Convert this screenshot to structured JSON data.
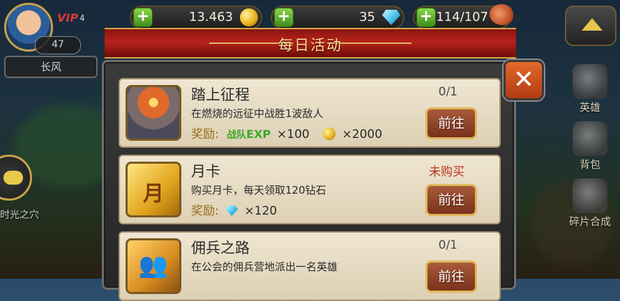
{
  "player": {
    "vip_label": "VIP",
    "vip_level": "4",
    "level": "47",
    "name": "长风"
  },
  "resources": {
    "gold": "13.463",
    "diamonds": "35",
    "stamina": "114/107"
  },
  "dialog": {
    "title": "每日活动",
    "close_glyph": "✕"
  },
  "activities": [
    {
      "title": "踏上征程",
      "description": "在燃烧的远征中战胜1波敌人",
      "reward_label": "奖励:",
      "reward_exp_label": "战队",
      "reward_exp_word": "EXP",
      "reward_exp_amount": "×100",
      "reward_gold_amount": "×2000",
      "status": "0/1",
      "button": "前往"
    },
    {
      "title": "月卡",
      "description": "购买月卡，每天领取120钻石",
      "reward_label": "奖励:",
      "reward_diamond_amount": "×120",
      "status": "未购买",
      "button": "前往",
      "thumb_glyph": "月"
    },
    {
      "title": "佣兵之路",
      "description": "在公会的佣兵营地派出一名英雄",
      "status": "0/1",
      "button": "前往"
    }
  ],
  "side_menu": {
    "items": [
      "英雄",
      "背包",
      "碎片合成"
    ]
  },
  "left_partial_label": "时光之穴",
  "colors": {
    "title_banner": "#b8231b",
    "card_bg": "#efe6d2",
    "go_button": "#a85a3a",
    "go_button_border": "#e0b85a",
    "status_unbought": "#b8321a",
    "exp_green": "#3ea82a",
    "reward_gold": "#9a6a1a"
  }
}
